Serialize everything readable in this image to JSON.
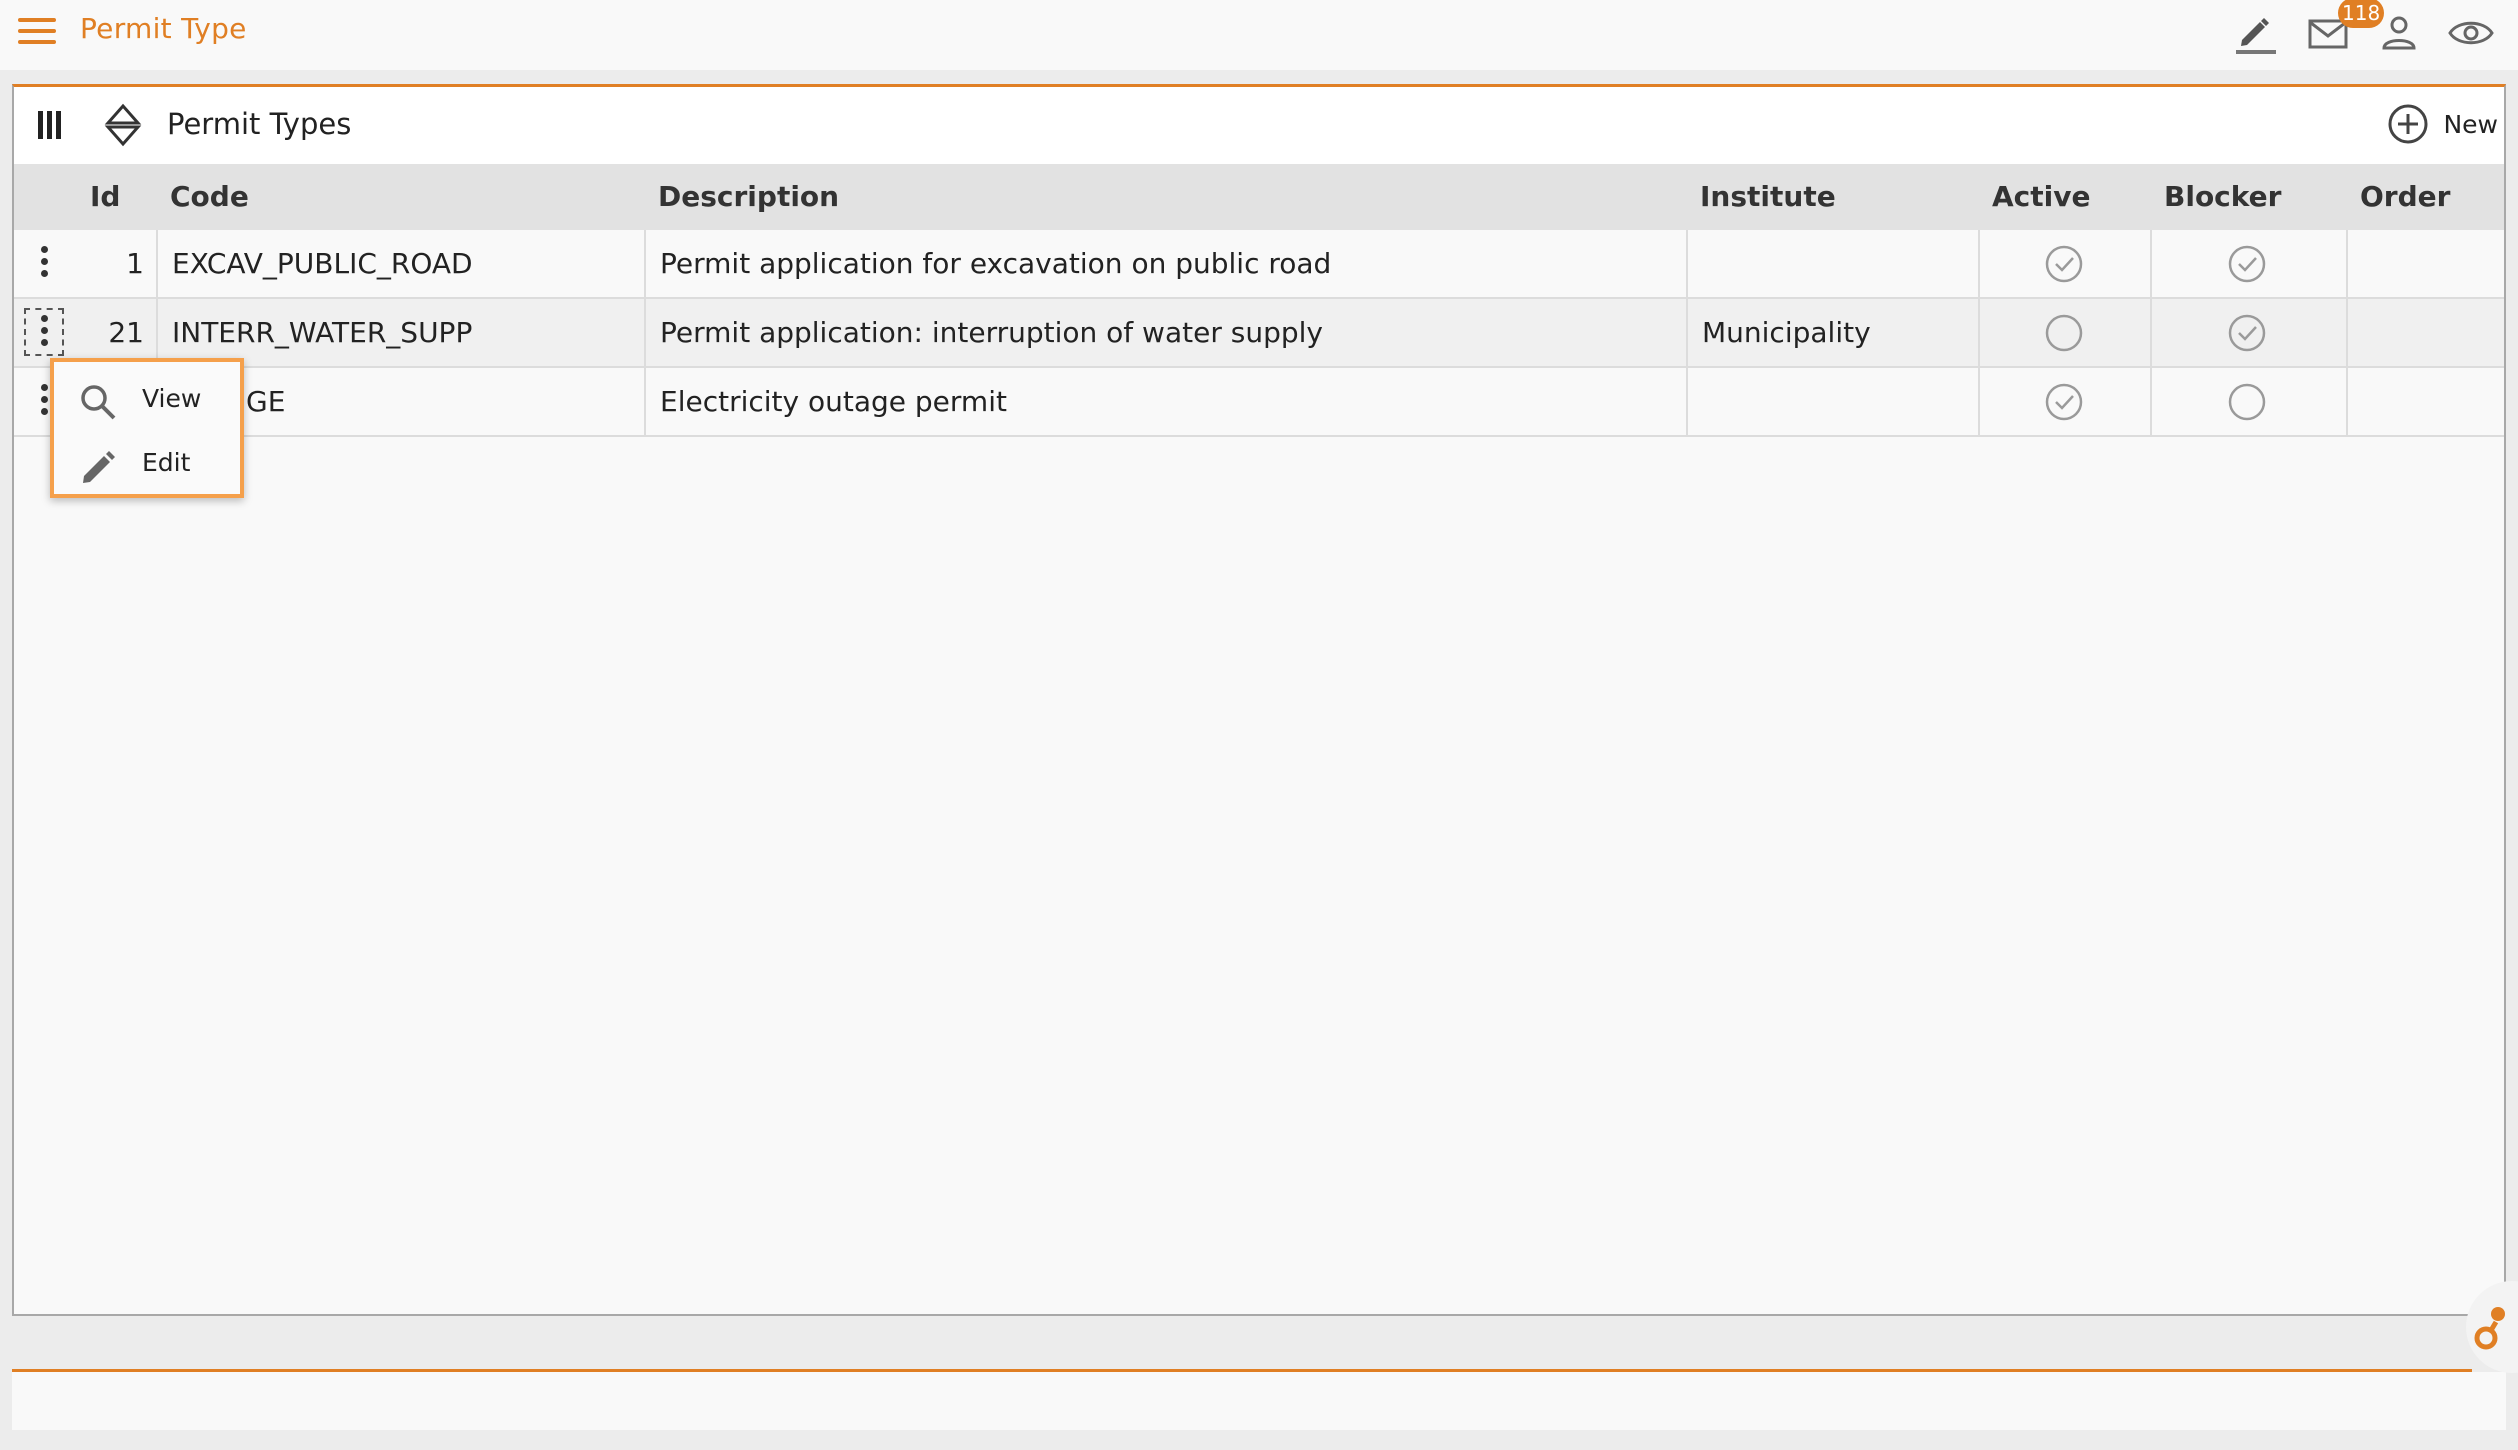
{
  "header": {
    "title": "Permit Type",
    "mail_count": "118",
    "icons": [
      "menu-icon",
      "edit-icon",
      "mail-icon",
      "user-icon",
      "eye-icon"
    ]
  },
  "panel": {
    "title": "Permit Types",
    "new_label": "New"
  },
  "table": {
    "columns": [
      "Id",
      "Code",
      "Description",
      "Institute",
      "Active",
      "Blocker",
      "Order"
    ],
    "rows": [
      {
        "id": "1",
        "code": "EXCAV_PUBLIC_ROAD",
        "description": "Permit application for excavation on public road",
        "institute": "",
        "active": true,
        "blocker": true,
        "order": ""
      },
      {
        "id": "21",
        "code": "INTERR_WATER_SUPP",
        "description": "Permit application: interruption of water supply",
        "institute": "Municipality",
        "active": false,
        "blocker": true,
        "order": ""
      },
      {
        "id": "",
        "code": "GE",
        "description": "Electricity outage permit",
        "institute": "",
        "active": true,
        "blocker": false,
        "order": ""
      }
    ]
  },
  "context_menu": {
    "items": [
      {
        "label": "View",
        "icon": "search-icon"
      },
      {
        "label": "Edit",
        "icon": "pencil-icon"
      }
    ]
  },
  "colors": {
    "accent": "#e07f24",
    "check": "#9a9a9a"
  }
}
